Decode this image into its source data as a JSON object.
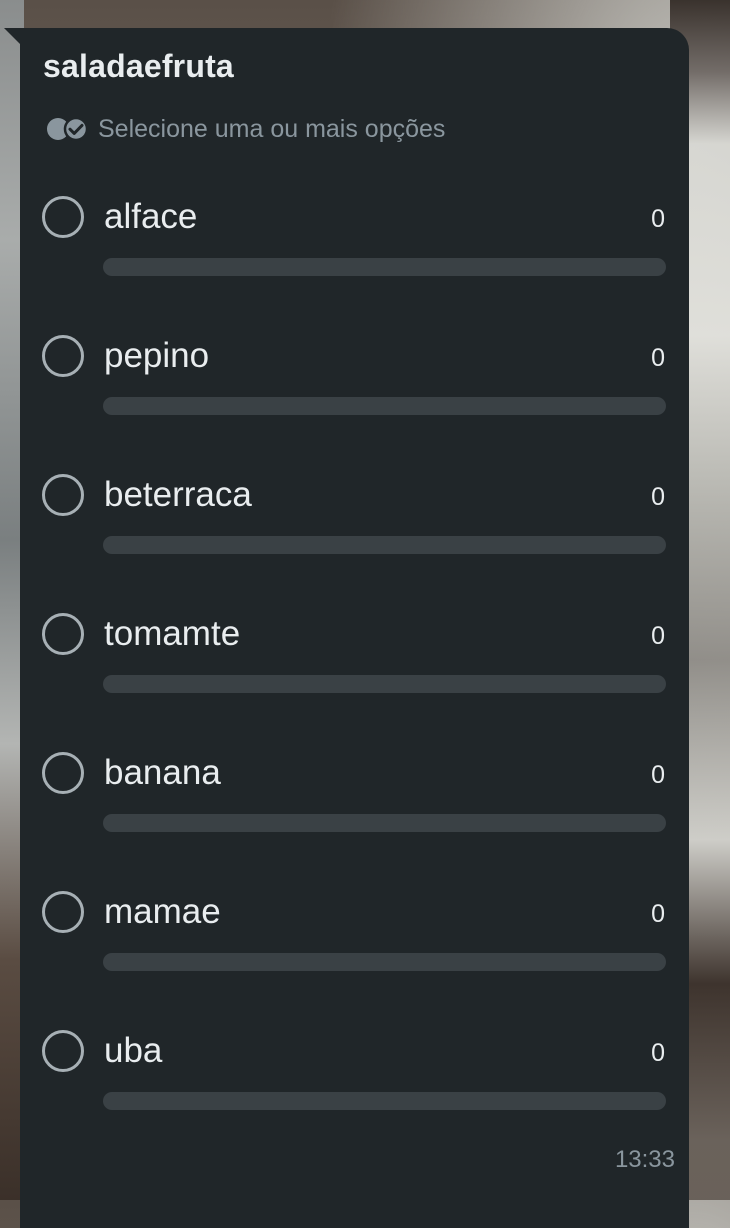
{
  "poll": {
    "title": "saladaefruta",
    "subtitle": "Selecione uma ou mais opções",
    "options": [
      {
        "label": "alface",
        "count": "0",
        "fraction": 0
      },
      {
        "label": "pepino",
        "count": "0",
        "fraction": 0
      },
      {
        "label": "beterraca",
        "count": "0",
        "fraction": 0
      },
      {
        "label": "tomamte",
        "count": "0",
        "fraction": 0
      },
      {
        "label": "banana",
        "count": "0",
        "fraction": 0
      },
      {
        "label": "mamae",
        "count": "0",
        "fraction": 0
      },
      {
        "label": "uba",
        "count": "0",
        "fraction": 0
      }
    ],
    "timestamp": "13:33"
  },
  "colors": {
    "bubble": "#202629",
    "text_primary": "#e9edef",
    "text_secondary": "#8a969e",
    "radio_border": "#a7b0b5",
    "progress_track": "#3a4145",
    "progress_fill": "#00a884"
  },
  "icons": {
    "subtitle_icon": "double-check-circle-icon",
    "option_icon": "radio-unchecked-icon"
  }
}
